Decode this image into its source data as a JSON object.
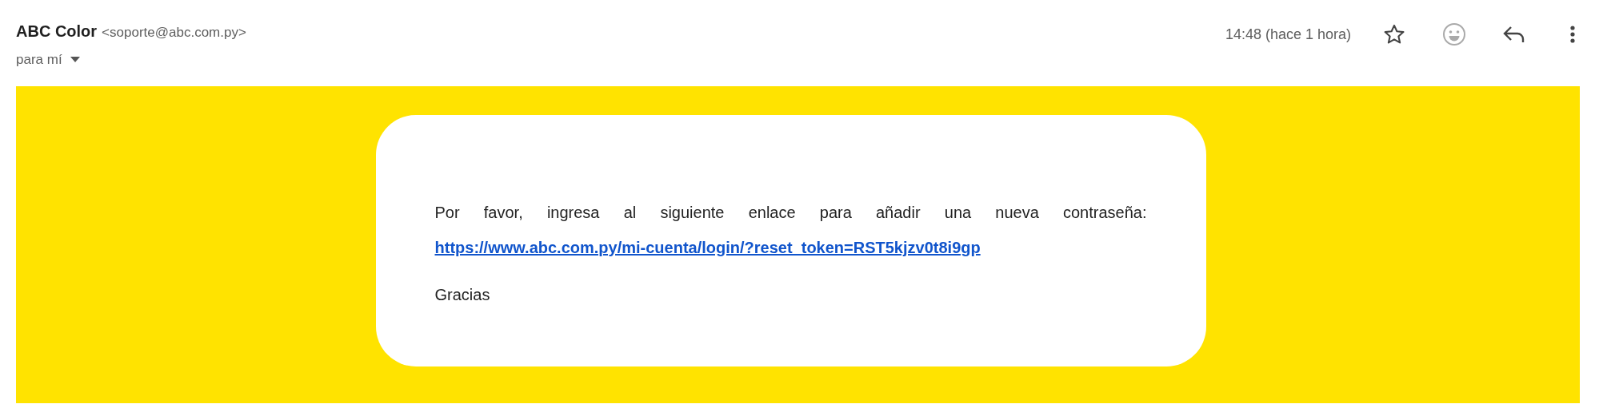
{
  "message": {
    "sender_name": "ABC Color",
    "sender_email": "<soporte@abc.com.py>",
    "recipient": "para mí",
    "time": "14:48 (hace 1 hora)",
    "starred": false
  },
  "body": {
    "text": "Por favor, ingresa al siguiente enlace para añadir una nueva contraseña:",
    "link": "https://www.abc.com.py/mi-cuenta/login/?reset_token=RST5kjzv0t8i9gp",
    "closing": "Gracias"
  }
}
